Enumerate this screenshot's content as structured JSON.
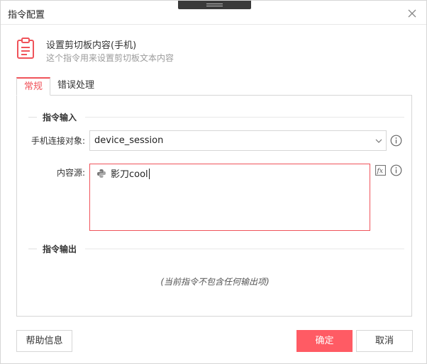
{
  "window": {
    "title": "指令配置"
  },
  "header": {
    "title": "设置剪切板内容(手机)",
    "subtitle": "这个指令用来设置剪切板文本内容",
    "icon": "clipboard-icon"
  },
  "tabs": [
    {
      "label": "常规",
      "active": true
    },
    {
      "label": "错误处理",
      "active": false
    }
  ],
  "input_section": {
    "title": "指令输入",
    "device": {
      "label": "手机连接对象:",
      "value": "device_session"
    },
    "content": {
      "label": "内容源:",
      "value": "影刀cool"
    }
  },
  "output_section": {
    "title": "指令输出",
    "empty_text": "(当前指令不包含任何输出项)"
  },
  "footer": {
    "help_label": "帮助信息",
    "ok_label": "确定",
    "cancel_label": "取消"
  },
  "colors": {
    "accent": "#f0535a",
    "primary_button": "#ff5b64"
  }
}
